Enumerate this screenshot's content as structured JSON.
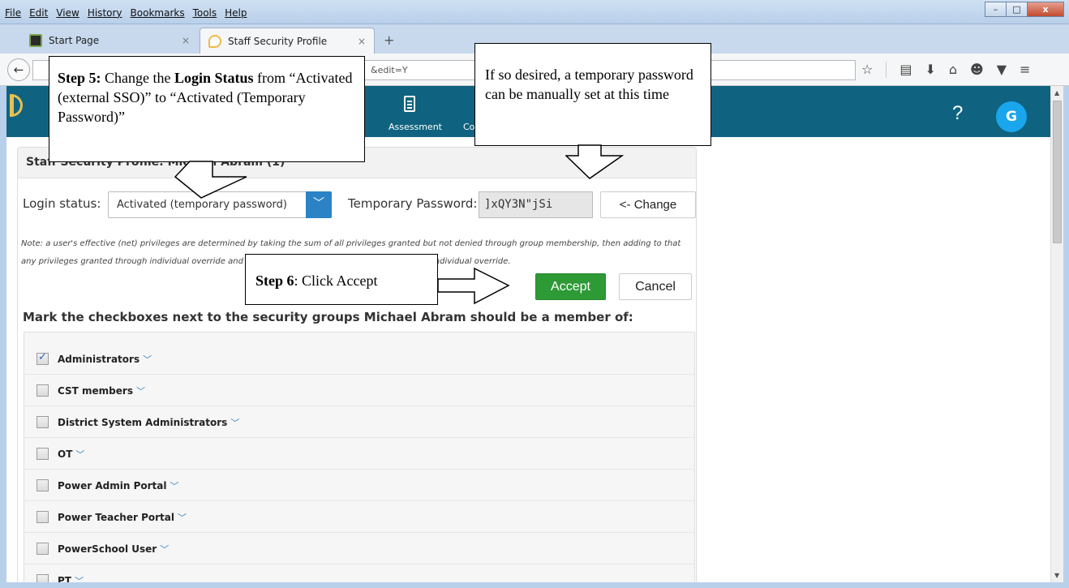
{
  "browser": {
    "menu": [
      "File",
      "Edit",
      "View",
      "History",
      "Bookmarks",
      "Tools",
      "Help"
    ],
    "window_buttons": {
      "minimize": "–",
      "maximize": "□",
      "close": "x"
    },
    "tabs": [
      {
        "label": "Start Page",
        "close": "×"
      },
      {
        "label": "Staff Security Profile",
        "close": "×"
      }
    ],
    "new_tab": "+",
    "url_fragment": "&edit=Y"
  },
  "app": {
    "nav_assessment": "Assessment",
    "nav_partial": "Co",
    "help": "?",
    "avatar_initial": "G",
    "colors": {
      "header": "#0f6380",
      "accent": "#2b83c6",
      "accept": "#2e9a36",
      "avatar": "#1aa6ec"
    }
  },
  "profile": {
    "title": "Staff Security Profile: Michael Abram (1)",
    "login_status_label": "Login status:",
    "login_status_value": "Activated (temporary password)",
    "temp_password_label": "Temporary Password:",
    "temp_password_value": "]xQY3N\"jSi",
    "change_button": "<- Change",
    "note": "Note: a user's effective (net) privileges are determined by taking the sum of all privileges granted but not denied through group membership, then adding to that any privileges granted through individual override and then removing any privileges denied through individual override.",
    "accept_button": "Accept",
    "cancel_button": "Cancel",
    "groups_heading": "Mark the checkboxes next to the security groups Michael Abram should be a member of:",
    "groups": [
      {
        "name": "Administrators",
        "checked": true
      },
      {
        "name": "CST members",
        "checked": false
      },
      {
        "name": "District System Administrators",
        "checked": false
      },
      {
        "name": "OT",
        "checked": false
      },
      {
        "name": "Power Admin Portal",
        "checked": false
      },
      {
        "name": "Power Teacher Portal",
        "checked": false
      },
      {
        "name": "PowerSchool User",
        "checked": false
      },
      {
        "name": "PT",
        "checked": false
      }
    ]
  },
  "callouts": {
    "step5_bold1": "Step 5:",
    "step5_text1": " Change the ",
    "step5_bold2": "Login Status",
    "step5_text2": " from “Activated (external SSO)” to “Activated (Temporary Password)”",
    "password_note": "If so desired, a temporary password can be manually set at this time",
    "step6_bold": "Step 6",
    "step6_text": ": Click Accept"
  }
}
